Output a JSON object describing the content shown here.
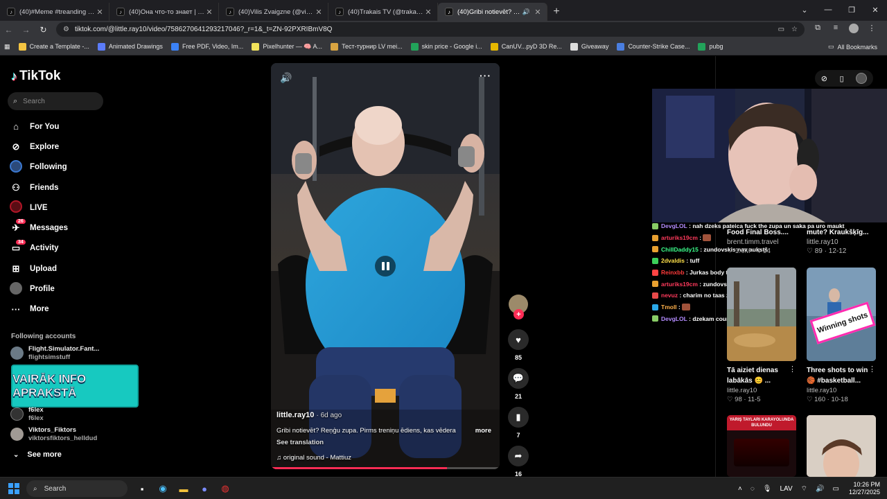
{
  "browser": {
    "tabs": [
      {
        "title": "(40)#Meme #treanding #fy #ti",
        "active": false
      },
      {
        "title": "(40)Она что-то знает | TikTok",
        "active": false
      },
      {
        "title": "(40)Vilis Zvaigzne (@vilis.zvaig",
        "active": false
      },
      {
        "title": "(40)Trakais TV (@trakais_viking",
        "active": false
      },
      {
        "title": "(40)Gribi notievēt? Reņģu z",
        "active": true
      }
    ],
    "url": "tiktok.com/@little.ray10/video/7586270641293217046?_r=1&_t=ZN-92PXRIBmV8Q",
    "bookmarks": [
      {
        "label": "Create a Template -...",
        "color": "#f5c542"
      },
      {
        "label": "Animated Drawings",
        "color": "#5b7cfa"
      },
      {
        "label": "Free PDF, Video, Im...",
        "color": "#3b82f6"
      },
      {
        "label": "Pixelhunter — 🧠 A...",
        "color": "#f2e35b"
      },
      {
        "label": "Тест-турнир LV mei...",
        "color": "#d9a441"
      },
      {
        "label": "skin price - Google i...",
        "color": "#22a35a"
      },
      {
        "label": "CanUV...pyD 3D Re...",
        "color": "#e6b800"
      },
      {
        "label": "Giveaway",
        "color": "#dddddd"
      },
      {
        "label": "Counter-Strike Case...",
        "color": "#4a7ee0"
      },
      {
        "label": "pubg",
        "color": "#22a35a"
      }
    ],
    "all_bookmarks": "All Bookmarks"
  },
  "sidebar": {
    "logo": "TikTok",
    "search_placeholder": "Search",
    "nav": [
      {
        "label": "For You",
        "icon": "home-icon"
      },
      {
        "label": "Explore",
        "icon": "compass-icon"
      },
      {
        "label": "Following",
        "icon": "following-avatar-icon"
      },
      {
        "label": "Friends",
        "icon": "friends-icon"
      },
      {
        "label": "LIVE",
        "icon": "live-icon"
      },
      {
        "label": "Messages",
        "icon": "messages-icon",
        "badge": "26"
      },
      {
        "label": "Activity",
        "icon": "activity-icon",
        "badge": "34"
      },
      {
        "label": "Upload",
        "icon": "upload-icon"
      },
      {
        "label": "Profile",
        "icon": "profile-icon"
      },
      {
        "label": "More",
        "icon": "more-icon"
      }
    ],
    "following_title": "Following accounts",
    "following": [
      {
        "name": "Flight.Simulator.Fant...",
        "handle": "flightsimstuff"
      },
      {
        "name": "f6lex",
        "handle": "f6lex"
      },
      {
        "name": "Viktors_Fiktors",
        "handle": "viktorsfiktors_helldud"
      }
    ],
    "promo_text": "VAIRĀK INFO APRAKSTĀ",
    "see_more": "See more"
  },
  "video": {
    "author": "little.ray10",
    "ago": "· 6d ago",
    "description": "Gribi notievēt? Reņģu zupa. Pirms treniņu ēdiens, kas vēdera",
    "more": "more",
    "see_translation": "See translation",
    "sound": "original sound - Mattiuz",
    "progress": 0.77
  },
  "actions": {
    "likes": "85",
    "comments": "21",
    "saves": "7",
    "shares": "16"
  },
  "chat": [
    {
      "user": "DevgLOL",
      "msg": "nah dzeks pateica fuck the zupa un saka pa uro maukt",
      "color": "#b48cff",
      "icon": "#8c6"
    },
    {
      "user": "arturiks19cm",
      "msg": "",
      "color": "#ff3a5c",
      "icon": "#e8a030"
    },
    {
      "user": "ChillDaddy15",
      "msg": "zundovskis nav aukstš",
      "color": "#3cff8c",
      "icon": "#e8a030"
    },
    {
      "user": "2dvaldis",
      "msg": "tuff",
      "color": "#ffe14a",
      "icon": "#3ccf5a"
    },
    {
      "user": "Reinxbb",
      "msg": "Jurkas body type",
      "color": "#ff3a3a",
      "icon": "#ff4444"
    },
    {
      "user": "arturiks19cm",
      "msg": "zundovska sencis",
      "color": "#ff3a5c",
      "icon": "#e8a030"
    },
    {
      "user": "nevuz",
      "msg": "charim no taas zupas svars uz augsu iet",
      "color": "#ff3a5c",
      "icon": "#e84a4a"
    },
    {
      "user": "Tmoll",
      "msg": "",
      "color": "#ffb04a",
      "icon": "#2aa8e8"
    },
    {
      "user": "DevgLOL",
      "msg": "dzekam counter weight",
      "color": "#b48cff",
      "icon": "#8c6"
    }
  ],
  "top_cards": [
    {
      "title_top": "Food Final Boss....",
      "author": "brent.timm.travel",
      "stats": "♡ 1.6M · 4-14"
    },
    {
      "title_top": "mute? Kraukšķīg...",
      "author": "little.ray10",
      "stats": "♡ 89 · 12-12"
    }
  ],
  "cards": [
    {
      "title": "Tā aiziet dienas labākās 😊 ...",
      "author": "little.ray10",
      "stats": "♡ 98 · 11-5"
    },
    {
      "title": "Three shots to win 🏀 #basketball...",
      "author": "little.ray10",
      "stats": "♡ 160 · 10-18",
      "overlay": "Winning shots"
    }
  ],
  "bottom_card_banner": "YARIŞ TAYLARI KARAYOLUNDA BULUNDU",
  "taskbar": {
    "search": "Search",
    "lang": "LAV",
    "time": "10:26 PM",
    "date": "12/27/2025"
  }
}
